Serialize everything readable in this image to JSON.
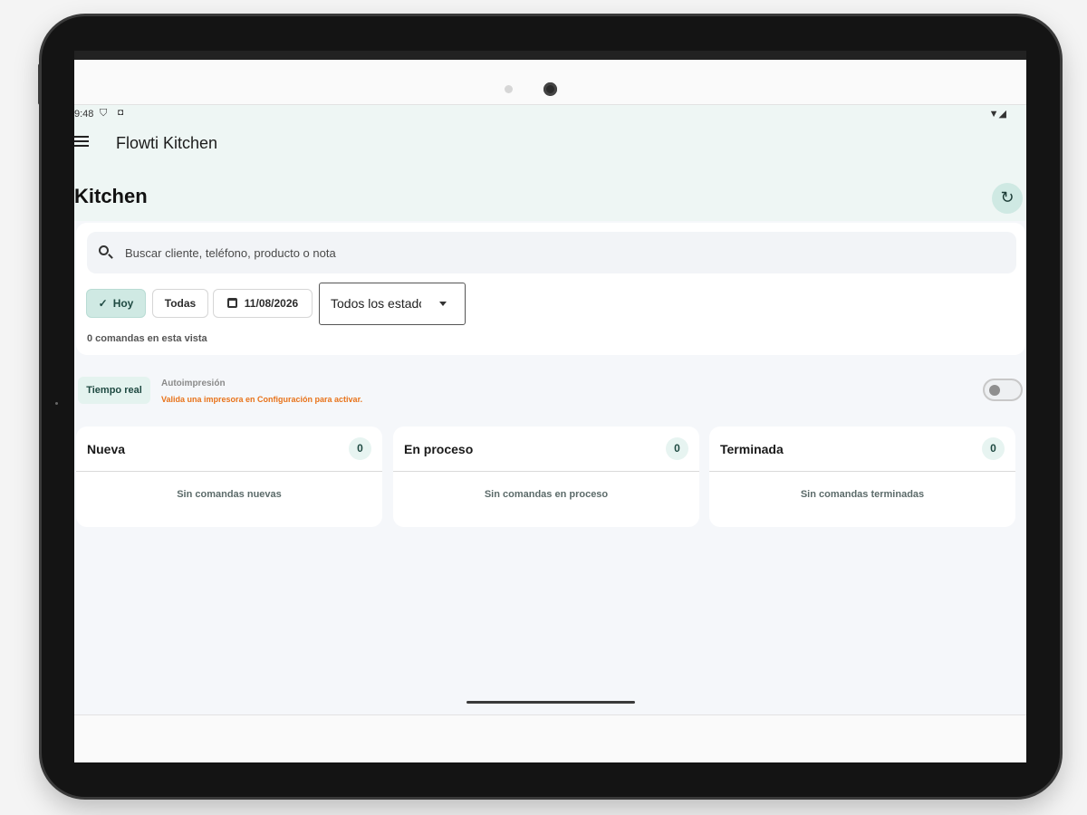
{
  "status_bar": {
    "time": "9:48",
    "icons_left": [
      "shield-icon",
      "notification-icon"
    ],
    "icons_right": [
      "wifi-icon",
      "signal-icon"
    ]
  },
  "appbar": {
    "title": "Flowti Kitchen",
    "menu_icon": "menu-icon"
  },
  "page": {
    "title": "Kitchen",
    "refresh_icon": "refresh-icon"
  },
  "filters": {
    "search_placeholder": "Buscar cliente, teléfono, producto o nota",
    "chip_hoy": "Hoy",
    "chip_todas": "Todas",
    "date": "11/08/2026",
    "status_select_value": "Todos los estados",
    "count_text": "0 comandas en esta vista"
  },
  "realtime": {
    "badge": "Tiempo real",
    "auto_title": "Autoimpresión",
    "auto_warning": "Valida una impresora en Configuración para activar.",
    "toggle_on": false
  },
  "columns": [
    {
      "title": "Nueva",
      "count": "0",
      "empty": "Sin comandas nuevas"
    },
    {
      "title": "En proceso",
      "count": "0",
      "empty": "Sin comandas en proceso"
    },
    {
      "title": "Terminada",
      "count": "0",
      "empty": "Sin comandas terminadas"
    }
  ],
  "colors": {
    "accent": "#cfe9e3",
    "warning": "#e8731a",
    "background": "#f5f7fa"
  }
}
